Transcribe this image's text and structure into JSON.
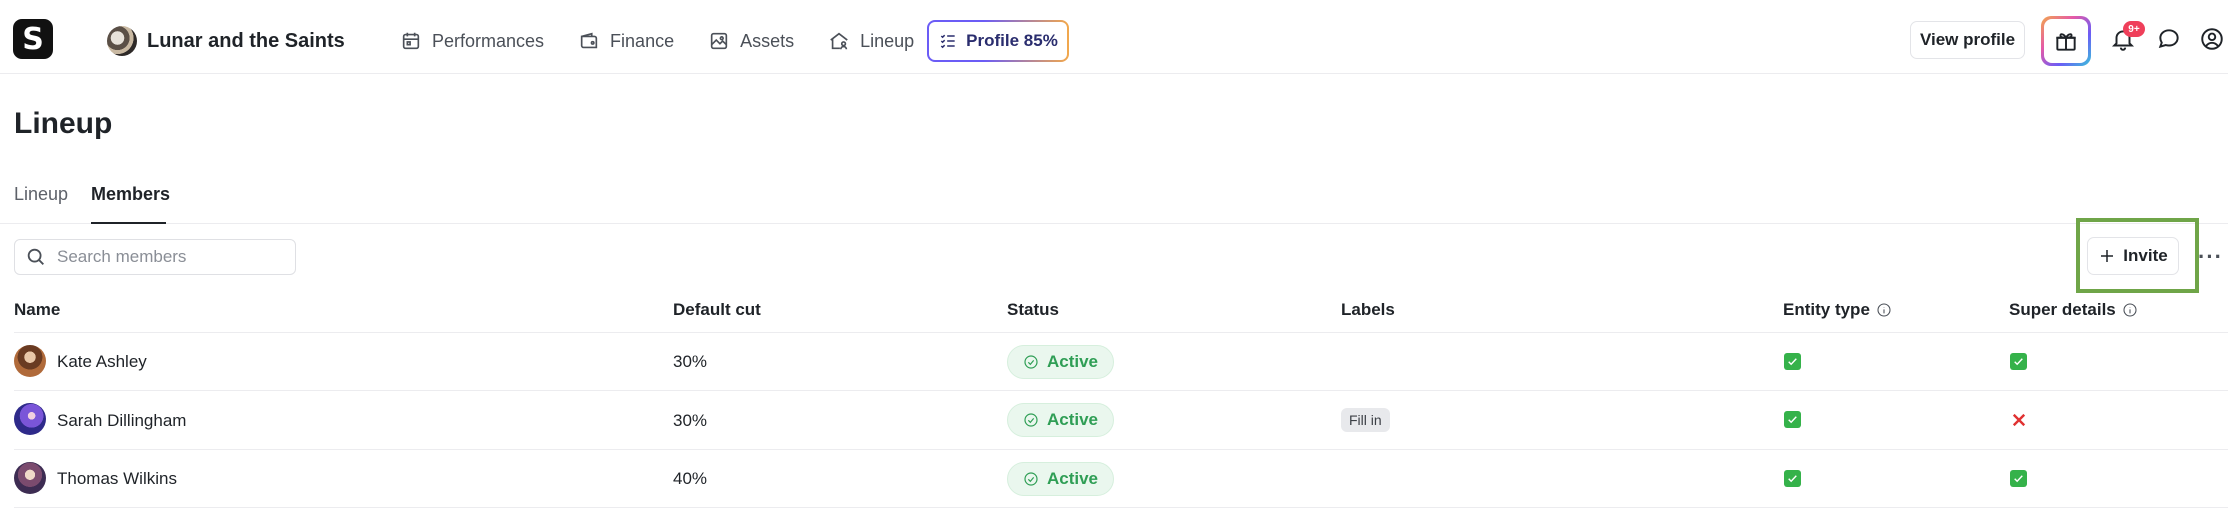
{
  "app": {
    "logo_letter": "S",
    "band_name": "Lunar and the Saints",
    "nav": [
      {
        "label": "Performances",
        "icon": "calendar-icon"
      },
      {
        "label": "Finance",
        "icon": "wallet-icon"
      },
      {
        "label": "Assets",
        "icon": "image-icon"
      },
      {
        "label": "Lineup",
        "icon": "house-people-icon"
      }
    ],
    "profile_label": "Profile 85%",
    "view_profile_label": "View profile",
    "notification_badge": "9+"
  },
  "page": {
    "title": "Lineup",
    "tabs": [
      {
        "label": "Lineup",
        "active": false
      },
      {
        "label": "Members",
        "active": true
      }
    ],
    "search_placeholder": "Search members",
    "invite_label": "Invite",
    "more_label": "···"
  },
  "table": {
    "headers": {
      "name": "Name",
      "default_cut": "Default cut",
      "status": "Status",
      "labels": "Labels",
      "entity_type": "Entity type",
      "super_details": "Super details"
    },
    "rows": [
      {
        "name": "Kate Ashley",
        "default_cut": "30%",
        "status": "Active",
        "label": "",
        "entity_type": true,
        "super_details": true
      },
      {
        "name": "Sarah Dillingham",
        "default_cut": "30%",
        "status": "Active",
        "label": "Fill in",
        "entity_type": true,
        "super_details": false
      },
      {
        "name": "Thomas Wilkins",
        "default_cut": "40%",
        "status": "Active",
        "label": "",
        "entity_type": true,
        "super_details": true
      }
    ]
  },
  "colors": {
    "status_green": "#2f9e55",
    "check_green": "#35b24a",
    "cross_red": "#e03131",
    "highlight_frame": "#6fa548"
  }
}
